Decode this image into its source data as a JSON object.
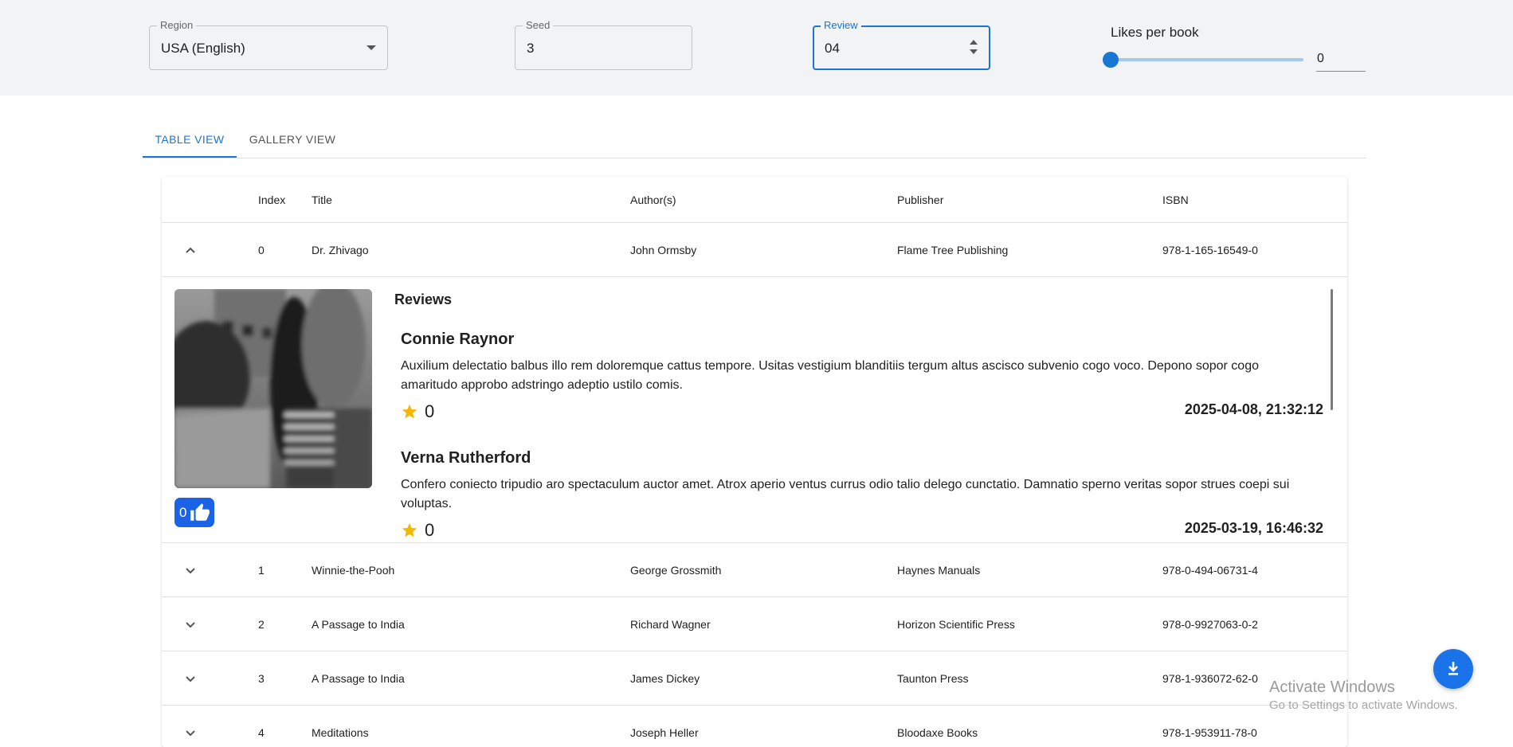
{
  "controls": {
    "region": {
      "label": "Region",
      "value": "USA (English)"
    },
    "seed": {
      "label": "Seed",
      "value": "3"
    },
    "review": {
      "label": "Review",
      "value": "04"
    },
    "likes": {
      "label": "Likes per book",
      "value": "0",
      "slider_fraction": 0
    }
  },
  "tabs": [
    {
      "label": "TABLE VIEW",
      "active": true
    },
    {
      "label": "GALLERY VIEW",
      "active": false
    }
  ],
  "table": {
    "headers": {
      "index": "Index",
      "title": "Title",
      "author": "Author(s)",
      "publisher": "Publisher",
      "isbn": "ISBN"
    },
    "rows": [
      {
        "index": "0",
        "title": "Dr. Zhivago",
        "author": "John Ormsby",
        "publisher": "Flame Tree Publishing",
        "isbn": "978-1-165-16549-0",
        "expanded": true
      },
      {
        "index": "1",
        "title": "Winnie-the-Pooh",
        "author": "George Grossmith",
        "publisher": "Haynes Manuals",
        "isbn": "978-0-494-06731-4",
        "expanded": false
      },
      {
        "index": "2",
        "title": "A Passage to India",
        "author": "Richard Wagner",
        "publisher": "Horizon Scientific Press",
        "isbn": "978-0-9927063-0-2",
        "expanded": false
      },
      {
        "index": "3",
        "title": "A Passage to India",
        "author": "James Dickey",
        "publisher": "Taunton Press",
        "isbn": "978-1-936072-62-0",
        "expanded": false
      },
      {
        "index": "4",
        "title": "Meditations",
        "author": "Joseph Heller",
        "publisher": "Bloodaxe Books",
        "isbn": "978-1-953911-78-0",
        "expanded": false
      }
    ]
  },
  "details": {
    "likes_count": "0",
    "reviews_title": "Reviews",
    "reviews": [
      {
        "author": "Connie Raynor",
        "text": "Auxilium delectatio balbus illo rem doloremque cattus tempore. Usitas vestigium blanditiis tergum altus ascisco subvenio cogo voco. Depono sopor cogo amaritudo approbo adstringo adeptio ustilo comis.",
        "rating": "0",
        "date": "2025-04-08, 21:32:12"
      },
      {
        "author": "Verna Rutherford",
        "text": "Confero coniecto tripudio aro spectaculum auctor amet. Atrox aperio ventus currus odio talio delego cunctatio. Damnatio sperno veritas sopor strues coepi sui voluptas.",
        "rating": "0",
        "date": "2025-03-19, 16:46:32"
      }
    ]
  },
  "watermark": {
    "line1": "Activate Windows",
    "line2": "Go to Settings to activate Windows."
  },
  "colors": {
    "accent": "#1976d2",
    "like_button": "#1a63e6",
    "fab": "#1a73e8",
    "star": "#f5b800",
    "controls_bg": "#f2f3f5"
  },
  "icons": {
    "like": "thumb-up-icon",
    "download": "download-icon",
    "star": "star-icon",
    "expand": "chevron-down-icon",
    "collapse": "chevron-up-icon"
  }
}
